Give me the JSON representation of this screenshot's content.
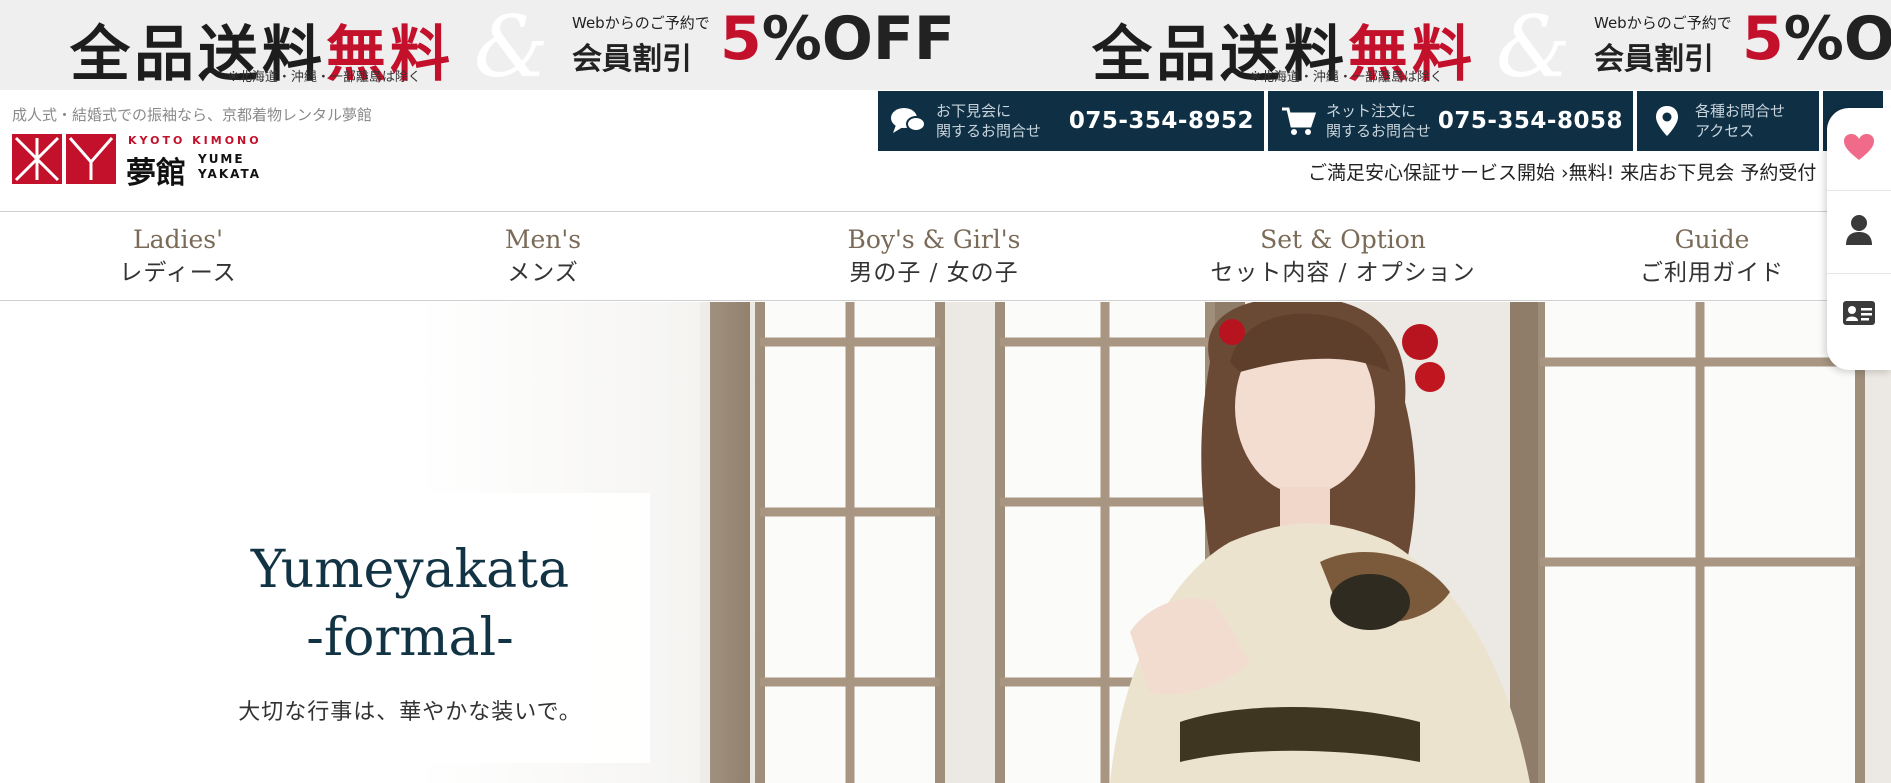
{
  "promo": {
    "headline_a": "全品送料",
    "headline_b": "無料",
    "note": "※北海道・沖縄・一部離島は除く",
    "amp": "&",
    "web_text": "Webからのご予約で",
    "member_text": "会員割引",
    "discount_num": "5",
    "discount_rest": "%OFF",
    "accent_color": "#c3102b"
  },
  "header": {
    "tagline": "成人式・結婚式での振袖なら、京都着物レンタル夢館",
    "logo_sub": "KYOTO KIMONO",
    "logo_jp": "夢館",
    "logo_en_1": "YUME",
    "logo_en_2": "YAKATA",
    "contacts": [
      {
        "icon": "chat-icon",
        "label_1": "お下見会に",
        "label_2": "関するお問合せ",
        "tel": "075-354-8952"
      },
      {
        "icon": "cart-icon",
        "label_1": "ネット注文に",
        "label_2": "関するお問合せ",
        "tel": "075-354-8058"
      },
      {
        "icon": "map-pin-icon",
        "label_1": "各種お問合せ",
        "label_2": "アクセス",
        "tel": ""
      }
    ],
    "notice": "ご満足安心保証サービス開始 ›無料! 来店お下見会 予約受付"
  },
  "nav": [
    {
      "en": "Ladies'",
      "jp": "レディース"
    },
    {
      "en": "Men's",
      "jp": "メンズ"
    },
    {
      "en": "Boy's & Girl's",
      "jp": "男の子 / 女の子"
    },
    {
      "en": "Set & Option",
      "jp": "セット内容 / オプション"
    },
    {
      "en": "Guide",
      "jp": "ご利用ガイド"
    }
  ],
  "hero": {
    "title_1": "Yumeyakata",
    "title_2": "-formal-",
    "subtitle": "大切な行事は、華やかな装いで。"
  },
  "side_panel": [
    {
      "icon": "heart-icon",
      "color": "#f06a8a"
    },
    {
      "icon": "user-icon",
      "color": "#3a3a3a"
    },
    {
      "icon": "id-card-icon",
      "color": "#3a3a3a"
    }
  ]
}
